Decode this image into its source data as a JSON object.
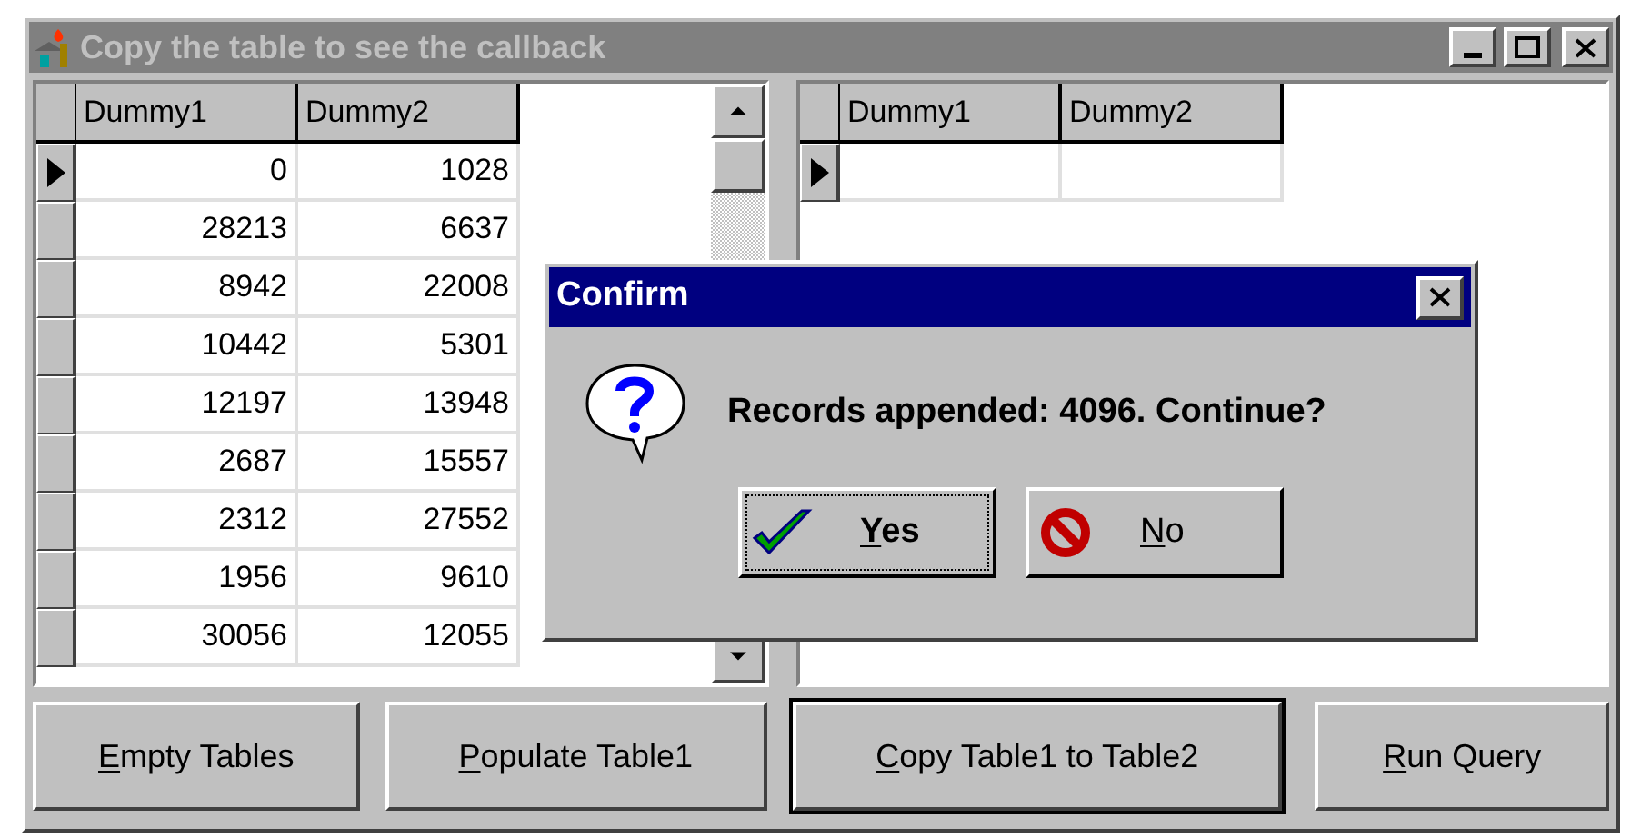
{
  "window": {
    "title": "Copy the table to see the callback",
    "active": false
  },
  "table1": {
    "columns": [
      "Dummy1",
      "Dummy2"
    ],
    "rows": [
      {
        "cells": [
          "0",
          "1028"
        ],
        "selected": true
      },
      {
        "cells": [
          "28213",
          "6637"
        ],
        "selected": false
      },
      {
        "cells": [
          "8942",
          "22008"
        ],
        "selected": false
      },
      {
        "cells": [
          "10442",
          "5301"
        ],
        "selected": false
      },
      {
        "cells": [
          "12197",
          "13948"
        ],
        "selected": false
      },
      {
        "cells": [
          "2687",
          "15557"
        ],
        "selected": false
      },
      {
        "cells": [
          "2312",
          "27552"
        ],
        "selected": false
      },
      {
        "cells": [
          "1956",
          "9610"
        ],
        "selected": false
      },
      {
        "cells": [
          "30056",
          "12055"
        ],
        "selected": false
      }
    ]
  },
  "table2": {
    "columns": [
      "Dummy1",
      "Dummy2"
    ],
    "rows": [
      {
        "selected": true
      }
    ]
  },
  "buttons": [
    {
      "key": "E",
      "after": "mpty Tables",
      "default": false
    },
    {
      "key": "P",
      "after": "opulate Table1",
      "default": false
    },
    {
      "key": "C",
      "after": "opy Table1 to Table2",
      "default": true
    },
    {
      "key": "R",
      "after": "un Query",
      "default": false
    }
  ],
  "dialog": {
    "title": "Confirm",
    "message": "Records appended: 4096. Continue?",
    "buttons": [
      {
        "kind": "yes",
        "key": "Y",
        "after": "es",
        "focused": true
      },
      {
        "kind": "no",
        "key": "N",
        "after": "o",
        "focused": false
      }
    ]
  }
}
